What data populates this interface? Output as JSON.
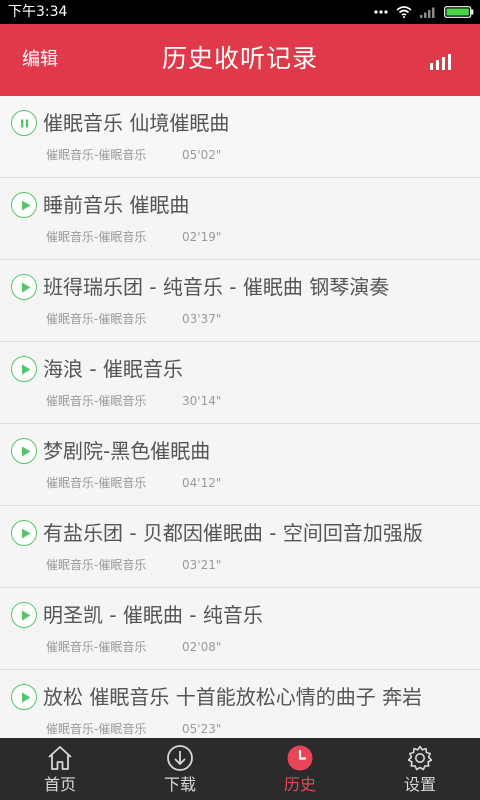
{
  "status_bar": {
    "time": "下午3:34",
    "icons": [
      "more-dots-icon",
      "wifi-icon",
      "cellular-icon",
      "battery-icon"
    ]
  },
  "header": {
    "edit_label": "编辑",
    "title": "历史收听记录",
    "right_icon": "equalizer-bars-icon"
  },
  "colors": {
    "accent": "#e03a4a",
    "play_green": "#58c46a",
    "nav_active": "#e84658",
    "nav_bg": "#2b2b2b"
  },
  "tracks": [
    {
      "title": "催眠音乐 仙境催眠曲",
      "album": "催眠音乐-催眠音乐",
      "duration": "05'02\"",
      "state": "playing",
      "icon": "pause-icon"
    },
    {
      "title": "睡前音乐 催眠曲",
      "album": "催眠音乐-催眠音乐",
      "duration": "02'19\"",
      "state": "stopped",
      "icon": "play-icon"
    },
    {
      "title": "班得瑞乐团 - 纯音乐 - 催眠曲 钢琴演奏",
      "album": "催眠音乐-催眠音乐",
      "duration": "03'37\"",
      "state": "stopped",
      "icon": "play-icon"
    },
    {
      "title": "海浪 - 催眠音乐",
      "album": "催眠音乐-催眠音乐",
      "duration": "30'14\"",
      "state": "stopped",
      "icon": "play-icon"
    },
    {
      "title": "梦剧院-黑色催眠曲",
      "album": "催眠音乐-催眠音乐",
      "duration": "04'12\"",
      "state": "stopped",
      "icon": "play-icon"
    },
    {
      "title": "有盐乐团 - 贝都因催眠曲 - 空间回音加强版",
      "album": "催眠音乐-催眠音乐",
      "duration": "03'21\"",
      "state": "stopped",
      "icon": "play-icon"
    },
    {
      "title": "明圣凯 - 催眠曲 - 纯音乐",
      "album": "催眠音乐-催眠音乐",
      "duration": "02'08\"",
      "state": "stopped",
      "icon": "play-icon"
    },
    {
      "title": "放松 催眠音乐 十首能放松心情的曲子 奔岩",
      "album": "催眠音乐-催眠音乐",
      "duration": "05'23\"",
      "state": "stopped",
      "icon": "play-icon"
    }
  ],
  "bottom_nav": {
    "tabs": [
      {
        "label": "首页",
        "icon": "home-icon",
        "active": false
      },
      {
        "label": "下载",
        "icon": "download-icon",
        "active": false
      },
      {
        "label": "历史",
        "icon": "history-clock-icon",
        "active": true
      },
      {
        "label": "设置",
        "icon": "settings-gear-icon",
        "active": false
      }
    ]
  }
}
